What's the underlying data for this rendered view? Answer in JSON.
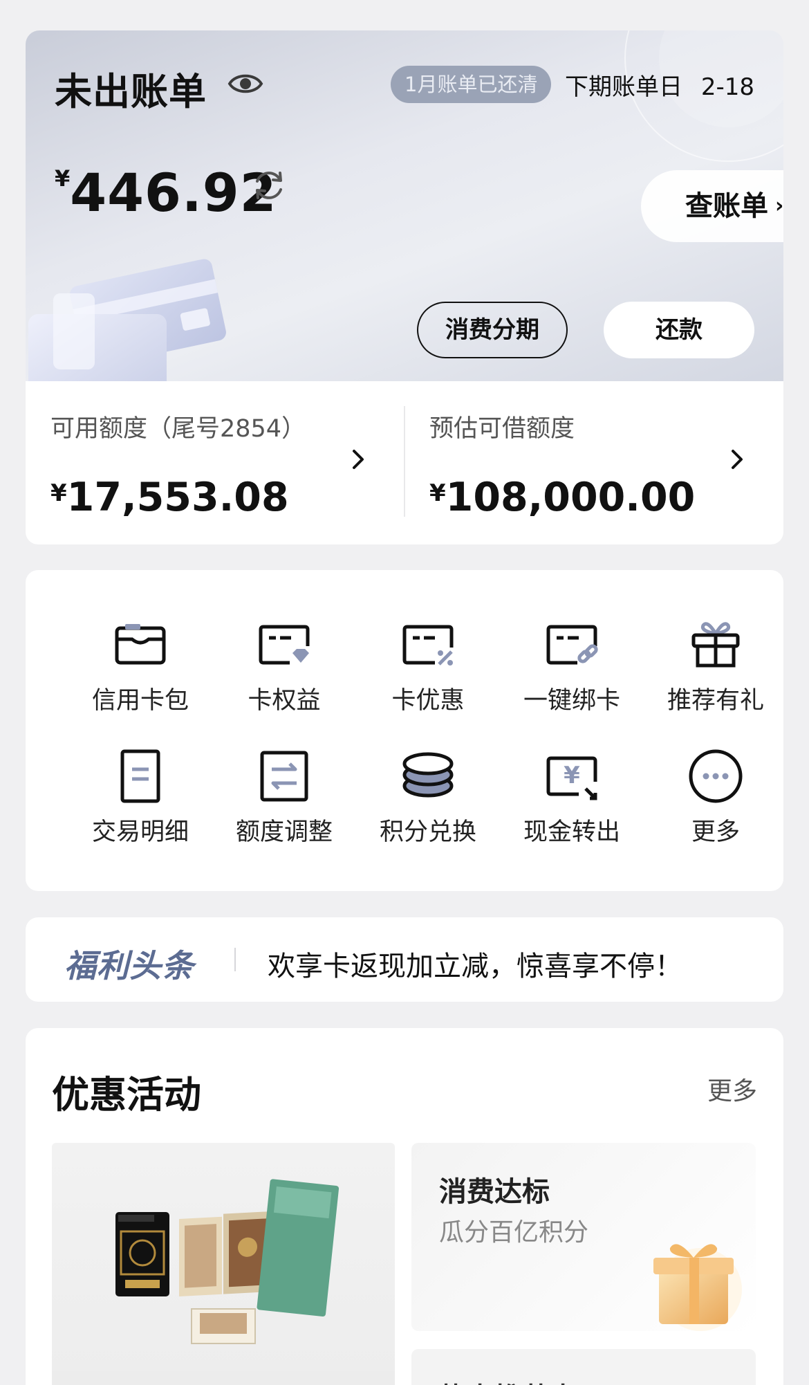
{
  "bill": {
    "title": "未出账单",
    "status_badge": "1月账单已还清",
    "next_bill_label": "下期账单日",
    "next_bill_date": "2-18",
    "currency": "¥",
    "amount": "446.92",
    "view_bill_label": "查账单",
    "installment_label": "消费分期",
    "repay_label": "还款"
  },
  "credit": {
    "available": {
      "label": "可用额度（尾号2854）",
      "currency": "¥",
      "value": "17,553.08"
    },
    "borrowable": {
      "label": "预估可借额度",
      "currency": "¥",
      "value": "108,000.00"
    }
  },
  "quick_actions": [
    {
      "label": "信用卡包",
      "icon": "card-wallet-icon"
    },
    {
      "label": "卡权益",
      "icon": "card-benefits-icon"
    },
    {
      "label": "卡优惠",
      "icon": "card-discount-icon"
    },
    {
      "label": "一键绑卡",
      "icon": "bind-card-icon"
    },
    {
      "label": "推荐有礼",
      "icon": "gift-icon"
    },
    {
      "label": "交易明细",
      "icon": "transactions-icon"
    },
    {
      "label": "额度调整",
      "icon": "limit-adjust-icon"
    },
    {
      "label": "积分兑换",
      "icon": "points-coins-icon"
    },
    {
      "label": "现金转出",
      "icon": "cash-out-icon"
    },
    {
      "label": "更多",
      "icon": "more-dots-icon"
    }
  ],
  "benefits": {
    "brand": "福利头条",
    "message": "欢享卡返现加立减，惊喜享不停！"
  },
  "promotions": {
    "title": "优惠活动",
    "more_label": "更多",
    "cards": [
      {
        "title": "消费达标",
        "subtitle": "瓜分百亿积分"
      },
      {
        "title": "热卡推荐卡"
      }
    ]
  }
}
